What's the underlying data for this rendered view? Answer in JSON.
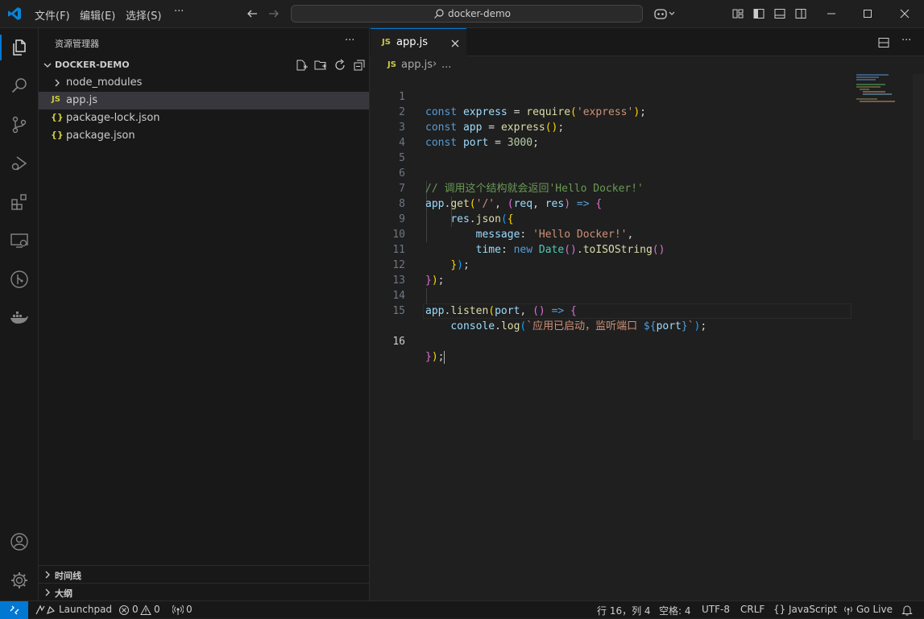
{
  "titlebar": {
    "menus": [
      "文件(F)",
      "编辑(E)",
      "选择(S)",
      "···"
    ],
    "search": "docker-demo"
  },
  "sidebar": {
    "title": "资源管理器",
    "more": "···",
    "folder": "DOCKER-DEMO",
    "items": [
      {
        "label": "node_modules",
        "kind": "folder"
      },
      {
        "label": "app.js",
        "kind": "js",
        "badge": "JS"
      },
      {
        "label": "package-lock.json",
        "kind": "json",
        "badge": "{}"
      },
      {
        "label": "package.json",
        "kind": "json",
        "badge": "{}"
      }
    ],
    "timeline": "时间线",
    "outline": "大纲"
  },
  "editor": {
    "tab": {
      "label": "app.js",
      "badge": "JS"
    },
    "breadcrumb": {
      "file": "app.js",
      "badge": "JS",
      "ellipsis": "..."
    },
    "current_line": 16,
    "line_numbers": [
      "1",
      "2",
      "3",
      "4",
      "5",
      "6",
      "7",
      "8",
      "9",
      "10",
      "11",
      "12",
      "13",
      "14",
      "15",
      "16"
    ]
  },
  "statusbar": {
    "launchpad": "Launchpad",
    "errors": "0",
    "warnings": "0",
    "ports": "0",
    "position": "行 16，列 4",
    "spaces": "空格: 4",
    "encoding": "UTF-8",
    "eol": "CRLF",
    "language": "JavaScript",
    "golive": "Go Live"
  },
  "colors": {
    "accent": "#0078d4",
    "background": "#1f1f1f",
    "sidebar": "#181818"
  }
}
